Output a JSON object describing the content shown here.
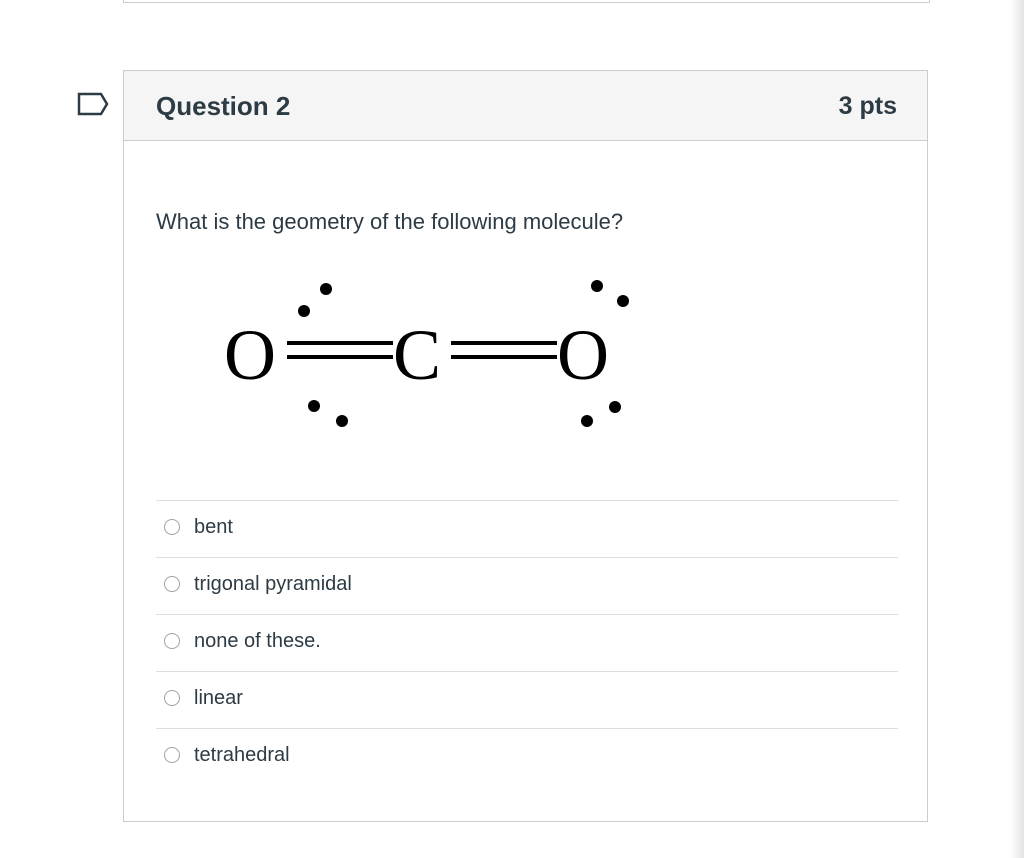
{
  "question": {
    "title": "Question 2",
    "points": "3 pts",
    "prompt": "What is the geometry of the following molecule?",
    "flag_icon": "flag-outline-icon",
    "molecule_labels": {
      "left_atom": "O",
      "center_atom": "C",
      "right_atom": "O"
    },
    "answers": [
      {
        "label": "bent"
      },
      {
        "label": "trigonal pyramidal"
      },
      {
        "label": "none of these."
      },
      {
        "label": "linear"
      },
      {
        "label": "tetrahedral"
      }
    ]
  },
  "colors": {
    "text": "#2d3b45",
    "border": "#c7cdd1",
    "header_bg": "#f5f5f5",
    "flag": "#2d3b45"
  }
}
